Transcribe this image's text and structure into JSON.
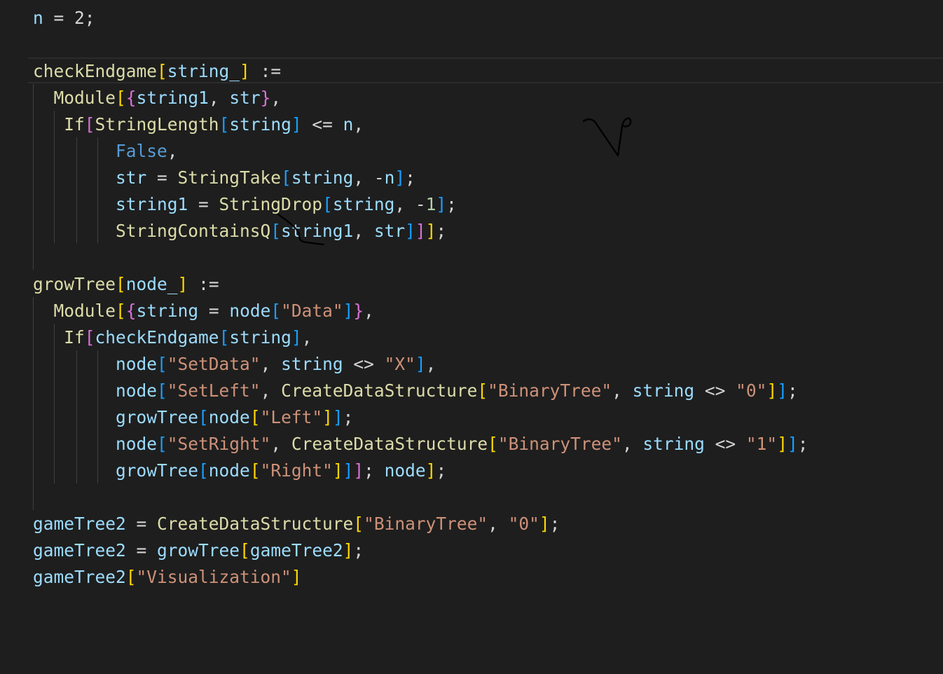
{
  "editor": {
    "language": "wolfram",
    "theme_colors": {
      "background": "#1e1e1e",
      "function": "#dcdcaa",
      "variable": "#9cdcfe",
      "plain": "#d4d4d4",
      "string": "#ce9178",
      "number": "#b5cea8",
      "keyword": "#569cd6",
      "bracket_level_1": "#ffd700",
      "bracket_level_2": "#da70d6",
      "bracket_level_3": "#179fff"
    },
    "lines": [
      {
        "tokens": [
          {
            "t": "n",
            "c": "var"
          },
          {
            "t": " = ",
            "c": "plain"
          },
          {
            "t": "2",
            "c": "plain"
          },
          {
            "t": ";",
            "c": "plain"
          }
        ]
      },
      {
        "tokens": []
      },
      {
        "tokens": [
          {
            "t": "checkEndgame",
            "c": "fn"
          },
          {
            "t": "[",
            "c": "b1"
          },
          {
            "t": "string_",
            "c": "var"
          },
          {
            "t": "]",
            "c": "b1"
          },
          {
            "t": " :=",
            "c": "plain"
          }
        ]
      },
      {
        "tokens": [
          {
            "t": "  ",
            "c": "plain"
          },
          {
            "t": "Module",
            "c": "fn"
          },
          {
            "t": "[",
            "c": "b1"
          },
          {
            "t": "{",
            "c": "b2"
          },
          {
            "t": "string1",
            "c": "var"
          },
          {
            "t": ", ",
            "c": "plain"
          },
          {
            "t": "str",
            "c": "var"
          },
          {
            "t": "}",
            "c": "b2"
          },
          {
            "t": ",",
            "c": "plain"
          }
        ]
      },
      {
        "tokens": [
          {
            "t": "   ",
            "c": "plain"
          },
          {
            "t": "If",
            "c": "fn"
          },
          {
            "t": "[",
            "c": "b2"
          },
          {
            "t": "StringLength",
            "c": "fn"
          },
          {
            "t": "[",
            "c": "b3"
          },
          {
            "t": "string",
            "c": "var"
          },
          {
            "t": "]",
            "c": "b3"
          },
          {
            "t": " <= ",
            "c": "plain"
          },
          {
            "t": "n",
            "c": "var"
          },
          {
            "t": ",",
            "c": "plain"
          }
        ]
      },
      {
        "tokens": [
          {
            "t": "        ",
            "c": "plain"
          },
          {
            "t": "False",
            "c": "kw"
          },
          {
            "t": ",",
            "c": "plain"
          }
        ]
      },
      {
        "tokens": [
          {
            "t": "        ",
            "c": "plain"
          },
          {
            "t": "str",
            "c": "var"
          },
          {
            "t": " = ",
            "c": "plain"
          },
          {
            "t": "StringTake",
            "c": "fn"
          },
          {
            "t": "[",
            "c": "b3"
          },
          {
            "t": "string",
            "c": "var"
          },
          {
            "t": ", -",
            "c": "plain"
          },
          {
            "t": "n",
            "c": "var"
          },
          {
            "t": "]",
            "c": "b3"
          },
          {
            "t": ";",
            "c": "plain"
          }
        ]
      },
      {
        "tokens": [
          {
            "t": "        ",
            "c": "plain"
          },
          {
            "t": "string1",
            "c": "var"
          },
          {
            "t": " = ",
            "c": "plain"
          },
          {
            "t": "StringDrop",
            "c": "fn"
          },
          {
            "t": "[",
            "c": "b3"
          },
          {
            "t": "string",
            "c": "var"
          },
          {
            "t": ", -",
            "c": "plain"
          },
          {
            "t": "1",
            "c": "num"
          },
          {
            "t": "]",
            "c": "b3"
          },
          {
            "t": ";",
            "c": "plain"
          }
        ]
      },
      {
        "tokens": [
          {
            "t": "        ",
            "c": "plain"
          },
          {
            "t": "StringContainsQ",
            "c": "fn"
          },
          {
            "t": "[",
            "c": "b3"
          },
          {
            "t": "string1",
            "c": "var"
          },
          {
            "t": ", ",
            "c": "plain"
          },
          {
            "t": "str",
            "c": "var"
          },
          {
            "t": "]",
            "c": "b3"
          },
          {
            "t": "]",
            "c": "b2"
          },
          {
            "t": "]",
            "c": "b1"
          },
          {
            "t": ";",
            "c": "plain"
          }
        ]
      },
      {
        "tokens": []
      },
      {
        "tokens": [
          {
            "t": "growTree",
            "c": "fn"
          },
          {
            "t": "[",
            "c": "b1"
          },
          {
            "t": "node_",
            "c": "var"
          },
          {
            "t": "]",
            "c": "b1"
          },
          {
            "t": " :=",
            "c": "plain"
          }
        ]
      },
      {
        "tokens": [
          {
            "t": "  ",
            "c": "plain"
          },
          {
            "t": "Module",
            "c": "fn"
          },
          {
            "t": "[",
            "c": "b1"
          },
          {
            "t": "{",
            "c": "b2"
          },
          {
            "t": "string",
            "c": "var"
          },
          {
            "t": " = ",
            "c": "plain"
          },
          {
            "t": "node",
            "c": "var"
          },
          {
            "t": "[",
            "c": "b3"
          },
          {
            "t": "\"Data\"",
            "c": "str"
          },
          {
            "t": "]",
            "c": "b3"
          },
          {
            "t": "}",
            "c": "b2"
          },
          {
            "t": ",",
            "c": "plain"
          }
        ]
      },
      {
        "tokens": [
          {
            "t": "   ",
            "c": "plain"
          },
          {
            "t": "If",
            "c": "fn"
          },
          {
            "t": "[",
            "c": "b2"
          },
          {
            "t": "checkEndgame",
            "c": "var"
          },
          {
            "t": "[",
            "c": "b3"
          },
          {
            "t": "string",
            "c": "var"
          },
          {
            "t": "]",
            "c": "b3"
          },
          {
            "t": ",",
            "c": "plain"
          }
        ]
      },
      {
        "tokens": [
          {
            "t": "        ",
            "c": "plain"
          },
          {
            "t": "node",
            "c": "var"
          },
          {
            "t": "[",
            "c": "b3"
          },
          {
            "t": "\"SetData\"",
            "c": "str"
          },
          {
            "t": ", ",
            "c": "plain"
          },
          {
            "t": "string",
            "c": "var"
          },
          {
            "t": " <> ",
            "c": "plain"
          },
          {
            "t": "\"X\"",
            "c": "str"
          },
          {
            "t": "]",
            "c": "b3"
          },
          {
            "t": ",",
            "c": "plain"
          }
        ]
      },
      {
        "tokens": [
          {
            "t": "        ",
            "c": "plain"
          },
          {
            "t": "node",
            "c": "var"
          },
          {
            "t": "[",
            "c": "b3"
          },
          {
            "t": "\"SetLeft\"",
            "c": "str"
          },
          {
            "t": ", ",
            "c": "plain"
          },
          {
            "t": "CreateDataStructure",
            "c": "fn"
          },
          {
            "t": "[",
            "c": "b1"
          },
          {
            "t": "\"BinaryTree\"",
            "c": "str"
          },
          {
            "t": ", ",
            "c": "plain"
          },
          {
            "t": "string",
            "c": "var"
          },
          {
            "t": " <> ",
            "c": "plain"
          },
          {
            "t": "\"0\"",
            "c": "str"
          },
          {
            "t": "]",
            "c": "b1"
          },
          {
            "t": "]",
            "c": "b3"
          },
          {
            "t": ";",
            "c": "plain"
          }
        ]
      },
      {
        "tokens": [
          {
            "t": "        ",
            "c": "plain"
          },
          {
            "t": "growTree",
            "c": "var"
          },
          {
            "t": "[",
            "c": "b3"
          },
          {
            "t": "node",
            "c": "var"
          },
          {
            "t": "[",
            "c": "b1"
          },
          {
            "t": "\"Left\"",
            "c": "str"
          },
          {
            "t": "]",
            "c": "b1"
          },
          {
            "t": "]",
            "c": "b3"
          },
          {
            "t": ";",
            "c": "plain"
          }
        ]
      },
      {
        "tokens": [
          {
            "t": "        ",
            "c": "plain"
          },
          {
            "t": "node",
            "c": "var"
          },
          {
            "t": "[",
            "c": "b3"
          },
          {
            "t": "\"SetRight\"",
            "c": "str"
          },
          {
            "t": ", ",
            "c": "plain"
          },
          {
            "t": "CreateDataStructure",
            "c": "fn"
          },
          {
            "t": "[",
            "c": "b1"
          },
          {
            "t": "\"BinaryTree\"",
            "c": "str"
          },
          {
            "t": ", ",
            "c": "plain"
          },
          {
            "t": "string",
            "c": "var"
          },
          {
            "t": " <> ",
            "c": "plain"
          },
          {
            "t": "\"1\"",
            "c": "str"
          },
          {
            "t": "]",
            "c": "b1"
          },
          {
            "t": "]",
            "c": "b3"
          },
          {
            "t": ";",
            "c": "plain"
          }
        ]
      },
      {
        "tokens": [
          {
            "t": "        ",
            "c": "plain"
          },
          {
            "t": "growTree",
            "c": "var"
          },
          {
            "t": "[",
            "c": "b3"
          },
          {
            "t": "node",
            "c": "var"
          },
          {
            "t": "[",
            "c": "b1"
          },
          {
            "t": "\"Right\"",
            "c": "str"
          },
          {
            "t": "]",
            "c": "b1"
          },
          {
            "t": "]",
            "c": "b3"
          },
          {
            "t": "]",
            "c": "b2"
          },
          {
            "t": "; ",
            "c": "plain"
          },
          {
            "t": "node",
            "c": "var"
          },
          {
            "t": "]",
            "c": "b1"
          },
          {
            "t": ";",
            "c": "plain"
          }
        ]
      },
      {
        "tokens": []
      },
      {
        "tokens": [
          {
            "t": "gameTree2",
            "c": "var"
          },
          {
            "t": " = ",
            "c": "plain"
          },
          {
            "t": "CreateDataStructure",
            "c": "fn"
          },
          {
            "t": "[",
            "c": "b1"
          },
          {
            "t": "\"BinaryTree\"",
            "c": "str"
          },
          {
            "t": ", ",
            "c": "plain"
          },
          {
            "t": "\"0\"",
            "c": "str"
          },
          {
            "t": "]",
            "c": "b1"
          },
          {
            "t": ";",
            "c": "plain"
          }
        ]
      },
      {
        "tokens": [
          {
            "t": "gameTree2",
            "c": "var"
          },
          {
            "t": " = ",
            "c": "plain"
          },
          {
            "t": "growTree",
            "c": "var"
          },
          {
            "t": "[",
            "c": "b1"
          },
          {
            "t": "gameTree2",
            "c": "var"
          },
          {
            "t": "]",
            "c": "b1"
          },
          {
            "t": ";",
            "c": "plain"
          }
        ]
      },
      {
        "tokens": [
          {
            "t": "gameTree2",
            "c": "var"
          },
          {
            "t": "[",
            "c": "b1"
          },
          {
            "t": "\"Visualization\"",
            "c": "str"
          },
          {
            "t": "]",
            "c": "b1"
          }
        ]
      }
    ]
  }
}
